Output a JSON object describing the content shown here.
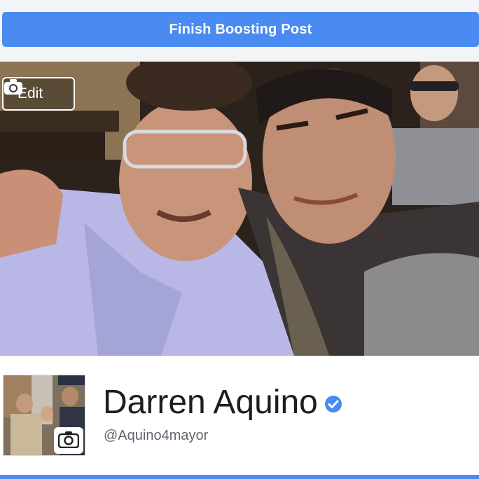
{
  "boost": {
    "label": "Finish Boosting Post"
  },
  "cover": {
    "edit_label": "Edit",
    "icon": "camera-icon"
  },
  "profile": {
    "name": "Darren Aquino",
    "handle": "@Aquino4mayor",
    "verified": true,
    "verified_icon": "verified-badge-icon",
    "avatar_icon": "camera-icon"
  },
  "colors": {
    "accent": "#4a8bf2",
    "verified": "#4a8bf2",
    "name_text": "#1c1e21",
    "handle_text": "#606770"
  }
}
